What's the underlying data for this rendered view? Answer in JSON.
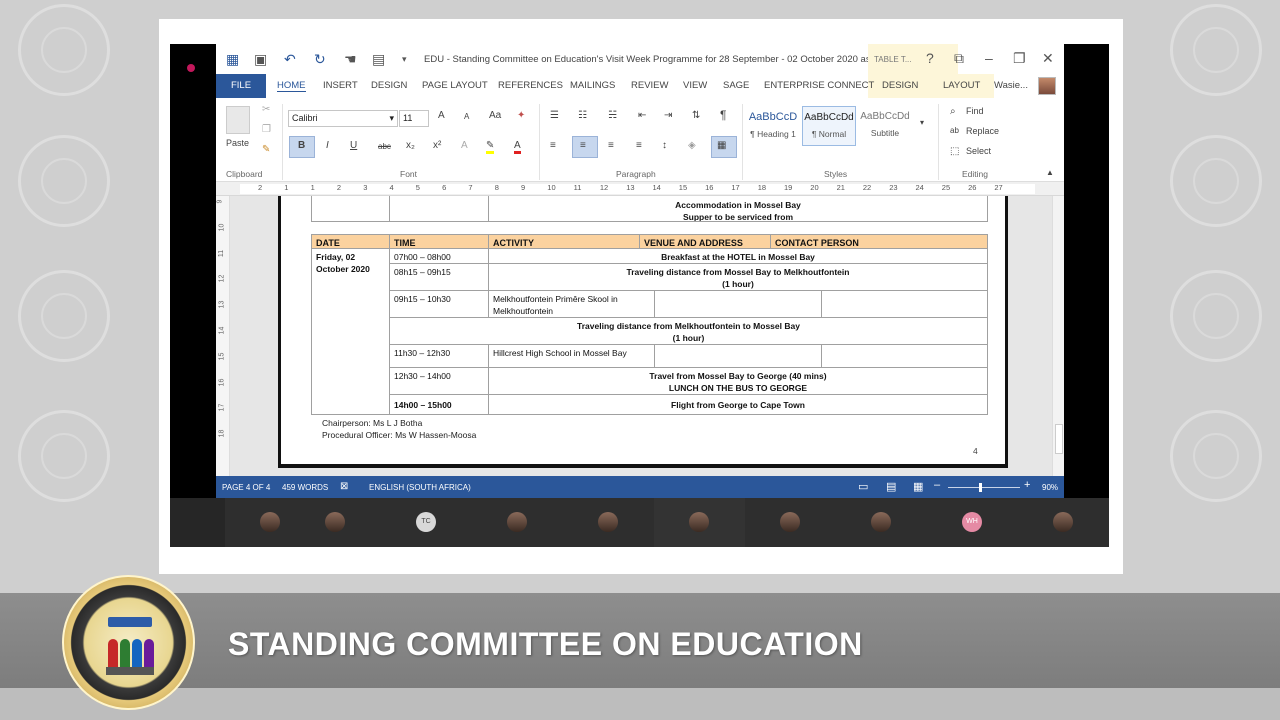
{
  "app": {
    "window_title": "EDU - Standing Committee on Education's Visit Week Programme for 28 September - 02 October 2020 as...",
    "table_tools_label": "TABLE T...",
    "help": "?",
    "user_name": "Wasie..."
  },
  "tabs": [
    "FILE",
    "HOME",
    "INSERT",
    "DESIGN",
    "PAGE LAYOUT",
    "REFERENCES",
    "MAILINGS",
    "REVIEW",
    "VIEW",
    "SAGE",
    "ENTERPRISE CONNECT",
    "DESIGN",
    "LAYOUT"
  ],
  "ribbon": {
    "paste_label": "Paste",
    "clipboard_label": "Clipboard",
    "font_name": "Calibri",
    "font_size": "11",
    "font_label": "Font",
    "paragraph_label": "Paragraph",
    "styles_label": "Styles",
    "editing_label": "Editing",
    "styles": [
      {
        "preview": "AaBbCcD",
        "name": "¶ Heading 1"
      },
      {
        "preview": "AaBbCcDd",
        "name": "¶ Normal"
      },
      {
        "preview": "AaBbCcDd",
        "name": "Subtitle"
      }
    ],
    "find": "Find",
    "replace": "Replace",
    "select": "Select",
    "bold": "B",
    "italic": "I",
    "underline": "U",
    "strike": "abc",
    "subscript": "x₂",
    "superscript": "x²",
    "grow_font": "A",
    "change_case": "Aa",
    "font_color": "A",
    "pilcrow": "¶"
  },
  "ruler": [
    "2",
    "1",
    "1",
    "2",
    "3",
    "4",
    "5",
    "6",
    "7",
    "8",
    "9",
    "10",
    "11",
    "12",
    "13",
    "14",
    "15",
    "16",
    "17",
    "18",
    "19",
    "20",
    "21",
    "22",
    "23",
    "24",
    "25",
    "26",
    "27"
  ],
  "vruler": [
    "9",
    "10",
    "11",
    "12",
    "13",
    "14",
    "15",
    "16",
    "17",
    "18"
  ],
  "document": {
    "top_text_1": "Accommodation in Mossel Bay",
    "top_text_2": "Supper to be serviced from",
    "headers": [
      "DATE",
      "TIME",
      "ACTIVITY",
      "VENUE AND ADDRESS",
      "CONTACT PERSON"
    ],
    "date": "Friday, 02 October 2020",
    "rows": [
      {
        "time": "07h00 – 08h00",
        "activity": "Breakfast at the HOTEL in Mossel Bay"
      },
      {
        "time": "08h15 – 09h15",
        "activity": "Traveling distance from Mossel Bay to Melkhoutfontein",
        "activity2": "(1 hour)"
      },
      {
        "time": "09h15 – 10h30",
        "activity": "Melkhoutfontein Primêre Skool in Melkhoutfontein"
      },
      {
        "activity": "Traveling distance from Melkhoutfontein  to Mossel Bay",
        "activity2": "(1 hour)"
      },
      {
        "time": "11h30 – 12h30",
        "activity": "Hillcrest High School in Mossel Bay"
      },
      {
        "time": "12h30 – 14h00",
        "activity": "Travel from Mossel Bay to George (40 mins)",
        "activity2": "LUNCH ON THE BUS TO GEORGE"
      },
      {
        "time": "14h00 – 15h00",
        "activity": "Flight from George to Cape Town"
      }
    ],
    "chairperson": "Chairperson: Ms L J Botha",
    "procedural_officer": "Procedural Officer: Ms W Hassen-Moosa",
    "page_number": "4"
  },
  "status": {
    "page": "PAGE 4 OF 4",
    "words": "459 WORDS",
    "language": "ENGLISH (SOUTH AFRICA)",
    "zoom": "90%"
  },
  "participants": [
    {
      "initials": ""
    },
    {
      "initials": ""
    },
    {
      "initials": "TC"
    },
    {
      "initials": ""
    },
    {
      "initials": ""
    },
    {
      "initials": ""
    },
    {
      "initials": ""
    },
    {
      "initials": ""
    },
    {
      "initials": "WH"
    },
    {
      "initials": ""
    }
  ],
  "banner": {
    "title": "STANDING COMMITTEE ON EDUCATION"
  },
  "colors": {
    "word_blue": "#2b579a",
    "header_orange": "#fbd29f",
    "banner_gray": "#8e8e8e"
  }
}
